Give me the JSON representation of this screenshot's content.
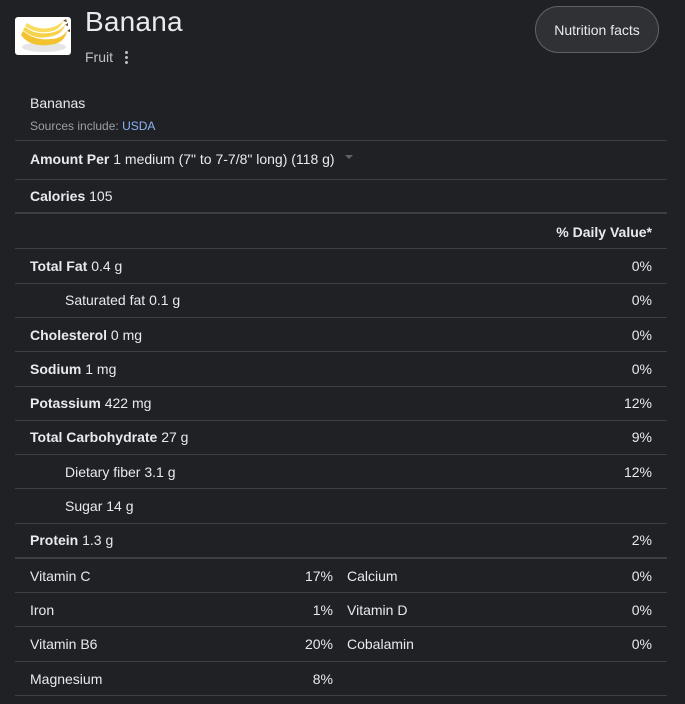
{
  "header": {
    "title": "Banana",
    "subtitle": "Fruit",
    "nutrition_button": "Nutrition facts"
  },
  "panel": {
    "food_name": "Bananas",
    "sources_prefix": "Sources include:",
    "source_link": "USDA",
    "amount_label": "Amount Per",
    "amount_value": "1 medium (7\" to 7-7/8\" long) (118 g)",
    "calories_label": "Calories",
    "calories_value": "105",
    "dv_header": "% Daily Value*",
    "nutrients": [
      {
        "label": "Total Fat",
        "amount": "0.4 g",
        "pct": "0%"
      },
      {
        "label": "Saturated fat",
        "amount": "0.1 g",
        "pct": "0%"
      },
      {
        "label": "Cholesterol",
        "amount": "0 mg",
        "pct": "0%"
      },
      {
        "label": "Sodium",
        "amount": "1 mg",
        "pct": "0%"
      },
      {
        "label": "Potassium",
        "amount": "422 mg",
        "pct": "12%"
      },
      {
        "label": "Total Carbohydrate",
        "amount": "27 g",
        "pct": "9%"
      },
      {
        "label": "Dietary fiber",
        "amount": "3.1 g",
        "pct": "12%"
      },
      {
        "label": "Sugar",
        "amount": "14 g",
        "pct": ""
      },
      {
        "label": "Protein",
        "amount": "1.3 g",
        "pct": "2%"
      }
    ],
    "vitamins": [
      {
        "name": "Vitamin C",
        "pct": "17%"
      },
      {
        "name": "Calcium",
        "pct": "0%"
      },
      {
        "name": "Iron",
        "pct": "1%"
      },
      {
        "name": "Vitamin D",
        "pct": "0%"
      },
      {
        "name": "Vitamin B6",
        "pct": "20%"
      },
      {
        "name": "Cobalamin",
        "pct": "0%"
      },
      {
        "name": "Magnesium",
        "pct": "8%"
      }
    ]
  },
  "colors": {
    "background": "#202124",
    "text": "#e8eaed",
    "muted": "#9aa0a6",
    "link": "#8ab4f8",
    "divider": "#3c4043"
  },
  "icons": {
    "thumbnail": "banana-image",
    "menu": "more-vert-icon",
    "dropdown": "caret-down-icon"
  }
}
